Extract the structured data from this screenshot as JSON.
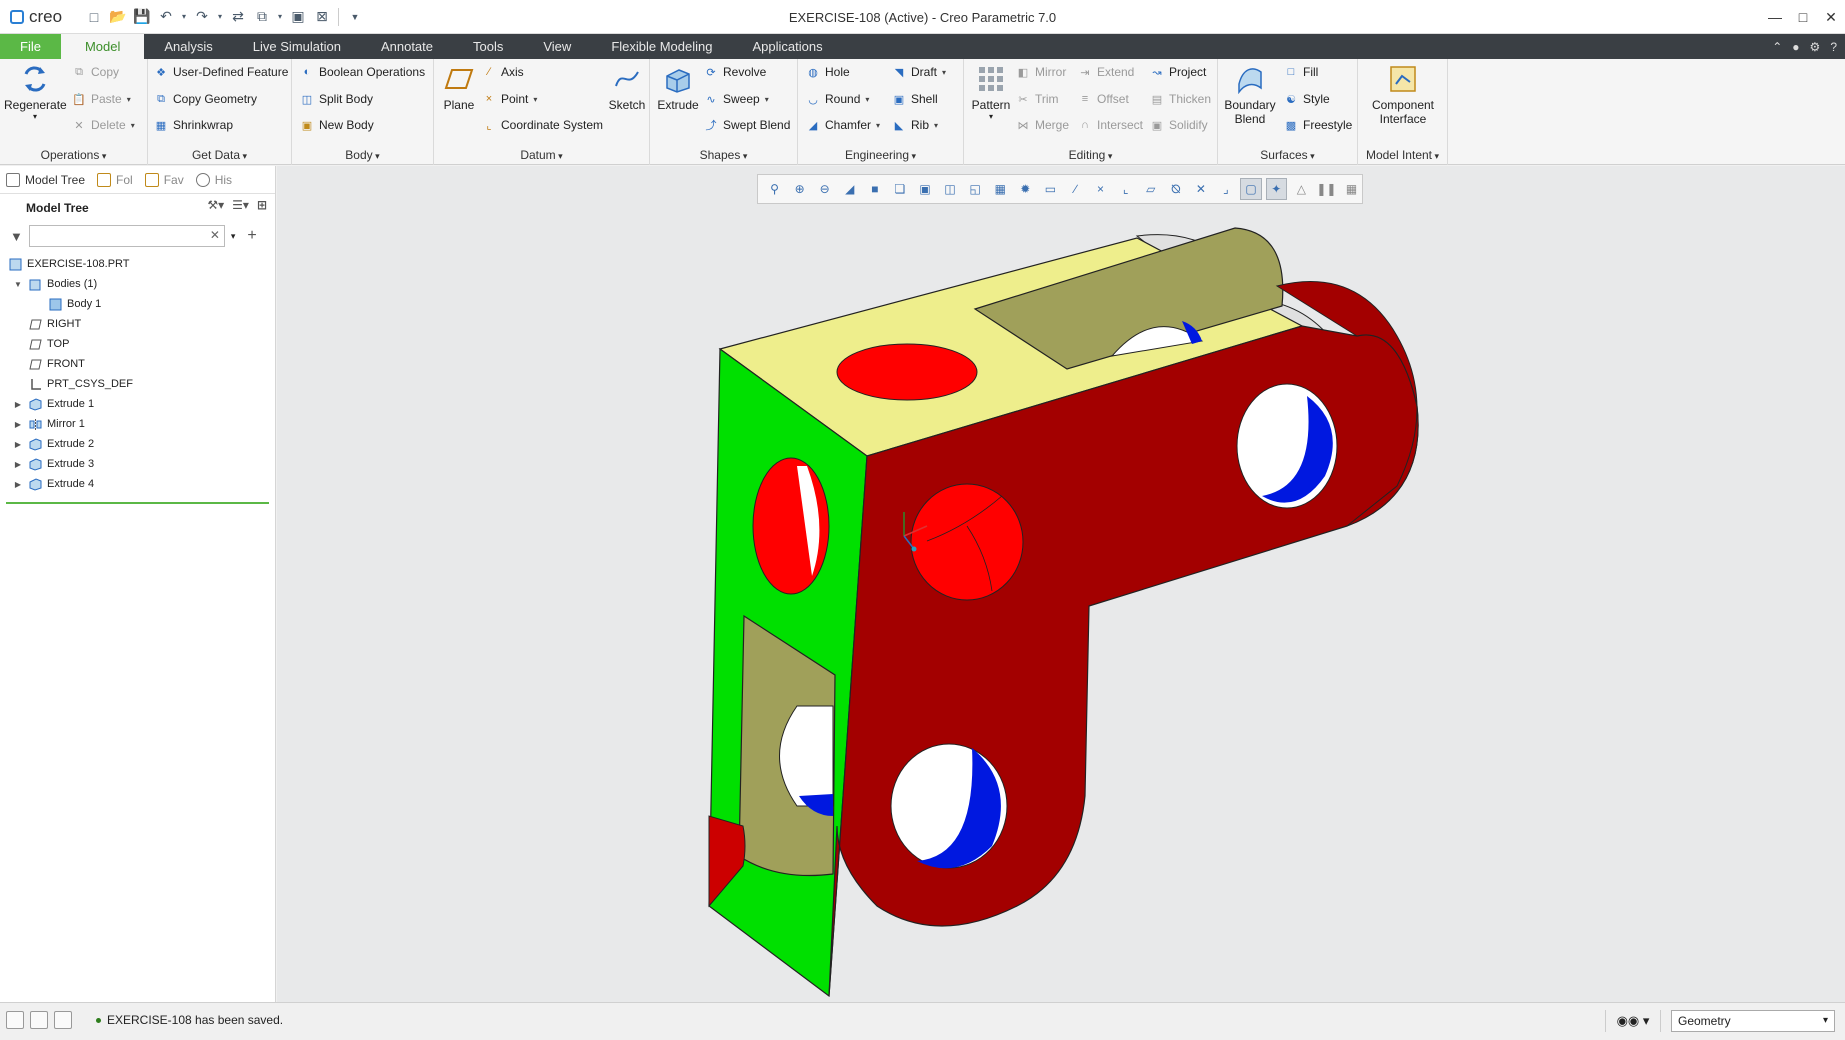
{
  "window": {
    "title": "EXERCISE-108 (Active) - Creo Parametric 7.0",
    "logo_text": "creo"
  },
  "ribbon_tabs": [
    "File",
    "Model",
    "Analysis",
    "Live Simulation",
    "Annotate",
    "Tools",
    "View",
    "Flexible Modeling",
    "Applications"
  ],
  "ribbon": {
    "operations": {
      "label": "Operations",
      "regenerate": "Regenerate",
      "copy": "Copy",
      "paste": "Paste",
      "delete": "Delete"
    },
    "get_data": {
      "label": "Get Data",
      "udf": "User-Defined Feature",
      "copy_geometry": "Copy Geometry",
      "shrinkwrap": "Shrinkwrap"
    },
    "body": {
      "label": "Body",
      "boolean": "Boolean Operations",
      "split": "Split Body",
      "new": "New Body"
    },
    "datum": {
      "label": "Datum",
      "plane": "Plane",
      "axis": "Axis",
      "point": "Point",
      "csys": "Coordinate System",
      "sketch": "Sketch"
    },
    "shapes": {
      "label": "Shapes",
      "extrude": "Extrude",
      "revolve": "Revolve",
      "sweep": "Sweep",
      "swept_blend": "Swept Blend"
    },
    "engineering": {
      "label": "Engineering",
      "hole": "Hole",
      "round": "Round",
      "chamfer": "Chamfer",
      "draft": "Draft",
      "shell": "Shell",
      "rib": "Rib"
    },
    "editing": {
      "label": "Editing",
      "pattern": "Pattern",
      "mirror": "Mirror",
      "trim": "Trim",
      "merge": "Merge",
      "extend": "Extend",
      "offset": "Offset",
      "intersect": "Intersect",
      "project": "Project",
      "thicken": "Thicken",
      "solidify": "Solidify"
    },
    "surfaces": {
      "label": "Surfaces",
      "boundary": "Boundary",
      "blend": "Blend",
      "fill": "Fill",
      "style": "Style",
      "freestyle": "Freestyle"
    },
    "model_intent": {
      "label": "Model Intent",
      "component": "Component",
      "interface": "Interface"
    }
  },
  "left_panel": {
    "tabs": [
      "Model Tree",
      "Fol",
      "Fav",
      "His"
    ],
    "tree_title": "Model Tree",
    "filter_value": "",
    "nodes": [
      {
        "label": "EXERCISE-108.PRT",
        "icon": "part-icon"
      },
      {
        "label": "Bodies (1)",
        "icon": "bodies-icon"
      },
      {
        "label": "Body 1",
        "icon": "body-icon"
      },
      {
        "label": "RIGHT",
        "icon": "datum-plane-icon"
      },
      {
        "label": "TOP",
        "icon": "datum-plane-icon"
      },
      {
        "label": "FRONT",
        "icon": "datum-plane-icon"
      },
      {
        "label": "PRT_CSYS_DEF",
        "icon": "csys-icon"
      },
      {
        "label": "Extrude 1",
        "icon": "extrude-icon"
      },
      {
        "label": "Mirror 1",
        "icon": "mirror-icon"
      },
      {
        "label": "Extrude 2",
        "icon": "extrude-icon"
      },
      {
        "label": "Extrude 3",
        "icon": "extrude-icon"
      },
      {
        "label": "Extrude 4",
        "icon": "extrude-icon"
      }
    ]
  },
  "status": {
    "message": "EXERCISE-108 has been saved.",
    "filter_select": "Geometry"
  },
  "colors": {
    "file_tab": "#5bb846",
    "tab_bar": "#3a3f44",
    "face_red": "#a30000",
    "face_green": "#00e000",
    "face_yellow": "#eeee8c",
    "face_olive": "#a0a05a",
    "hole_blue": "#0018e0"
  }
}
